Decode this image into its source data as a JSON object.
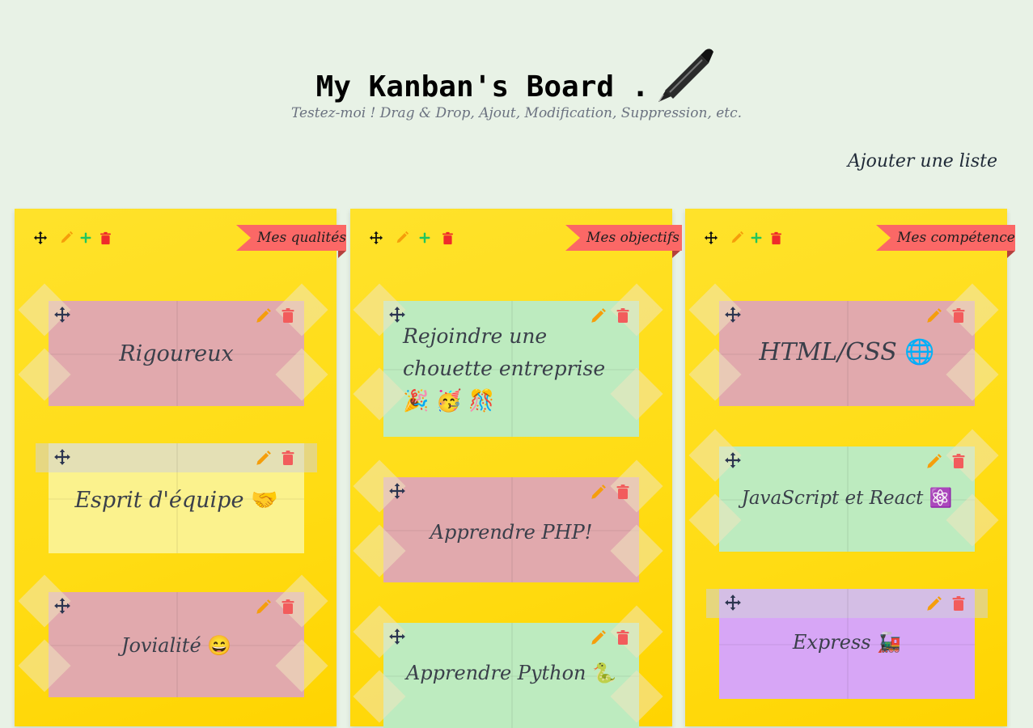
{
  "header": {
    "title": "My Kanban's Board .",
    "subtitle": "Testez-moi ! Drag & Drop, Ajout, Modification, Suppression, etc.",
    "add_list_label": "Ajouter une liste",
    "pen_icon": "fountain-pen-icon"
  },
  "colors": {
    "background": "#e8f2e6",
    "column": "#ffdc14",
    "ribbon": "#fb6866",
    "card_pink": "#e1a9ad",
    "card_green": "#bdebbf",
    "card_yellow": "#fbf28d",
    "card_purple": "#d7a6f6"
  },
  "lists": [
    {
      "title": "Mes qualités",
      "cards": [
        {
          "text": "Rigoureux",
          "emoji": "",
          "color": "pink"
        },
        {
          "text": "Esprit d'équipe",
          "emoji": "🤝",
          "color": "yellow"
        },
        {
          "text": "Jovialité",
          "emoji": "😄",
          "color": "pink"
        }
      ]
    },
    {
      "title": "Mes objectifs",
      "cards": [
        {
          "text": "Rejoindre une",
          "text2": "chouette entreprise",
          "emoji": "🎉 🥳 🎊",
          "color": "green"
        },
        {
          "text": "Apprendre PHP!",
          "emoji": "",
          "color": "pink"
        },
        {
          "text": "Apprendre Python",
          "emoji": "🐍",
          "color": "green"
        }
      ]
    },
    {
      "title": "Mes compétences",
      "cards": [
        {
          "text": "HTML/CSS",
          "emoji": "🌐",
          "color": "pink"
        },
        {
          "text": "JavaScript et React",
          "emoji": "⚛️",
          "color": "green"
        },
        {
          "text": "Express",
          "emoji": "🚂",
          "color": "purple"
        }
      ]
    }
  ]
}
